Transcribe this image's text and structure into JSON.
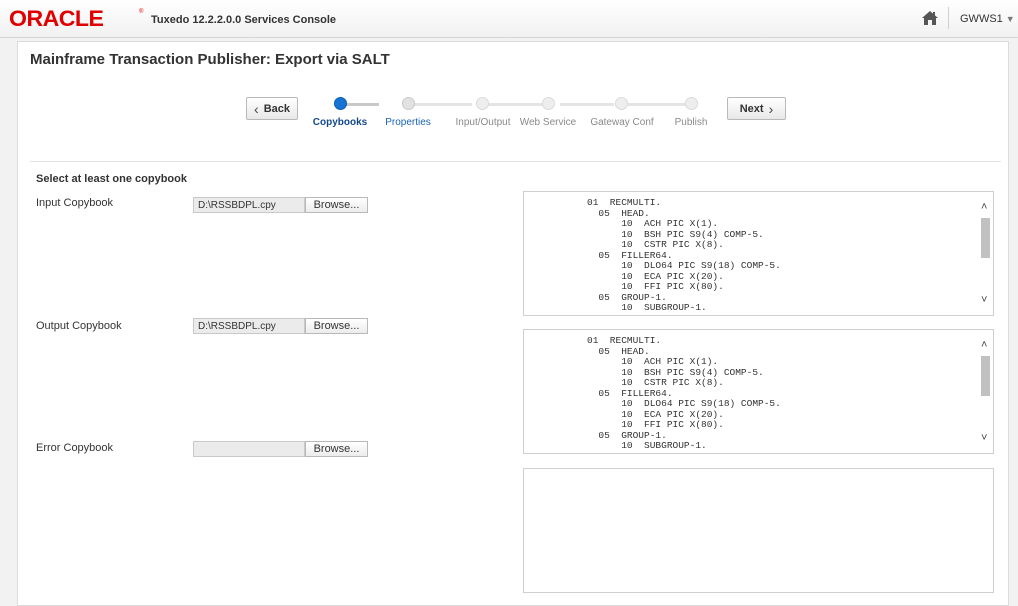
{
  "header": {
    "logo": "ORACLE",
    "app_title": "Tuxedo 12.2.2.0.0 Services Console",
    "user": "GWWS1",
    "icons": {
      "home": "home-icon",
      "caret": "chevron-down-icon"
    }
  },
  "page": {
    "title": "Mainframe Transaction Publisher: Export via SALT"
  },
  "train": {
    "back_label": "Back",
    "next_label": "Next",
    "steps": [
      {
        "label": "Copybooks",
        "state": "current"
      },
      {
        "label": "Properties",
        "state": "next"
      },
      {
        "label": "Input/Output",
        "state": "disabled"
      },
      {
        "label": "Web Service",
        "state": "disabled"
      },
      {
        "label": "Gateway Conf",
        "state": "disabled"
      },
      {
        "label": "Publish",
        "state": "disabled"
      }
    ]
  },
  "form": {
    "section_title": "Select at least one copybook",
    "browse_label": "Browse...",
    "fields": [
      {
        "label": "Input Copybook",
        "value": "D:\\RSSBDPL.cpy"
      },
      {
        "label": "Output Copybook",
        "value": "D:\\RSSBDPL.cpy"
      },
      {
        "label": "Error Copybook",
        "value": ""
      }
    ]
  },
  "previews": [
    {
      "lines": [
        "01  RECMULTI.",
        "  05  HEAD.",
        "      10  ACH PIC X(1).",
        "      10  BSH PIC S9(4) COMP-5.",
        "      10  CSTR PIC X(8).",
        "  05  FILLER64.",
        "      10  DLO64 PIC S9(18) COMP-5.",
        "      10  ECA PIC X(20).",
        "      10  FFI PIC X(80).",
        "  05  GROUP-1.",
        "      10  SUBGROUP-1."
      ]
    },
    {
      "lines": [
        "01  RECMULTI.",
        "  05  HEAD.",
        "      10  ACH PIC X(1).",
        "      10  BSH PIC S9(4) COMP-5.",
        "      10  CSTR PIC X(8).",
        "  05  FILLER64.",
        "      10  DLO64 PIC S9(18) COMP-5.",
        "      10  ECA PIC X(20).",
        "      10  FFI PIC X(80).",
        "  05  GROUP-1.",
        "      10  SUBGROUP-1."
      ]
    },
    {
      "lines": []
    }
  ],
  "colors": {
    "brand": "#e00000",
    "train_current": "#1673d1",
    "link": "#1a63b8"
  }
}
